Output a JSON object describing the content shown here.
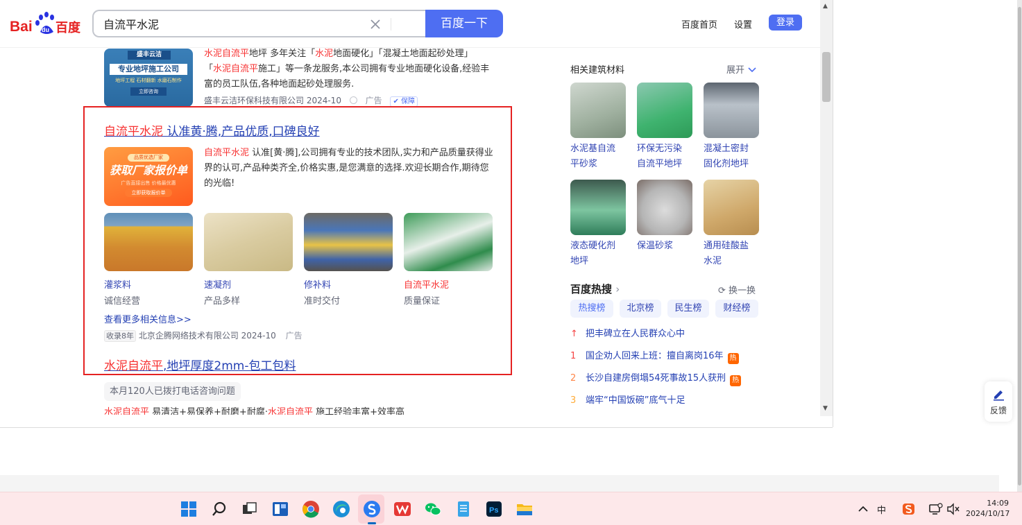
{
  "header": {
    "logo_text": "Bai百度",
    "search_value": "自流平水泥",
    "search_button": "百度一下",
    "links": [
      "百度首页",
      "设置"
    ],
    "login": "登录"
  },
  "results": {
    "first": {
      "thumb_top": "盛丰云洁",
      "thumb_mid": "专业地坪施工公司",
      "thumb_line": "地坪工程 石材翻新 水磨石制作",
      "thumb_btn": "立即咨询",
      "l1_a": "水泥自流平",
      "l1_b": "地坪 多年关注「",
      "l1_c": "水泥",
      "l1_d": "地面硬化」「混凝土地面起砂处理」",
      "l2_a": "「",
      "l2_b": "水泥自流平",
      "l2_c": "施工」等一条龙服务,本公司拥有专业地面硬化设备,经验丰",
      "l3": "富的员工队伍,各种地面起砂处理服务.",
      "source": "盛丰云洁环保科技有限公司 2024-10",
      "ad": "广告",
      "guarantee": "保障"
    },
    "ad": {
      "title_red": "自流平水泥",
      "title_rest": " 认准黄·腾,产品优质,口碑良好",
      "banner_top": "品质优选厂家",
      "banner_main": "获取厂家报价单",
      "banner_sub": "广告直接出售 价格最优惠",
      "banner_btn": "立即获取报价单",
      "desc_red": "自流平水泥",
      "desc_1": " 认准[黄·腾],公司拥有专业的技术团队,实力和产品质量获得业",
      "desc_2": "界的认可,产品种类齐全,价格实惠,是您满意的选择.欢迎长期合作,期待您",
      "desc_3": "的光临!",
      "products": [
        {
          "label": "灌浆料",
          "sub": "诚信经营"
        },
        {
          "label": "速凝剂",
          "sub": "产品多样"
        },
        {
          "label": "修补料",
          "sub": "准时交付"
        },
        {
          "label": "自流平水泥",
          "sub": "质量保证"
        }
      ],
      "more": "查看更多相关信息>>",
      "indexed": "收录8年",
      "source": "北京企腾网络技术有限公司 2024-10",
      "ad_tag": "广告"
    },
    "third": {
      "title_red": "水泥自流平",
      "title_rest": ",地坪厚度2mm-包工包料",
      "chip": "本月120人已拨打电话咨询问题",
      "snippet_red1": "水泥自流平",
      "snippet_1": " 易清洁+易保养+耐磨+耐腐·",
      "snippet_red2": "水泥自流平",
      "snippet_2": " 施工经验丰富+效率高"
    }
  },
  "sidebar": {
    "related_title": "相关建筑材料",
    "expand": "展开",
    "related": [
      {
        "l1": "水泥基自流",
        "l2": "平砂浆"
      },
      {
        "l1": "环保无污染",
        "l2": "自流平地坪"
      },
      {
        "l1": "混凝土密封",
        "l2": "固化剂地坪"
      },
      {
        "l1": "液态硬化剂",
        "l2": "地坪"
      },
      {
        "l1": "保温砂浆",
        "l2": ""
      },
      {
        "l1": "通用硅酸盐",
        "l2": "水泥"
      }
    ],
    "hot_title": "百度热搜",
    "refresh": "换一换",
    "tabs": [
      "热搜榜",
      "北京榜",
      "民生榜",
      "财经榜"
    ],
    "hot": [
      {
        "rank": "↑",
        "text": "把丰碑立在人民群众心中",
        "badge": ""
      },
      {
        "rank": "1",
        "text": "国企劝人回来上班：擅自离岗16年",
        "badge": "热"
      },
      {
        "rank": "2",
        "text": "长沙自建房倒塌54死事故15人获刑",
        "badge": "热"
      },
      {
        "rank": "3",
        "text": "端牢“中国饭碗”底气十足",
        "badge": ""
      }
    ]
  },
  "feedback": "反馈",
  "taskbar": {
    "time": "14:09",
    "date": "2024/10/17",
    "ime": "中"
  }
}
